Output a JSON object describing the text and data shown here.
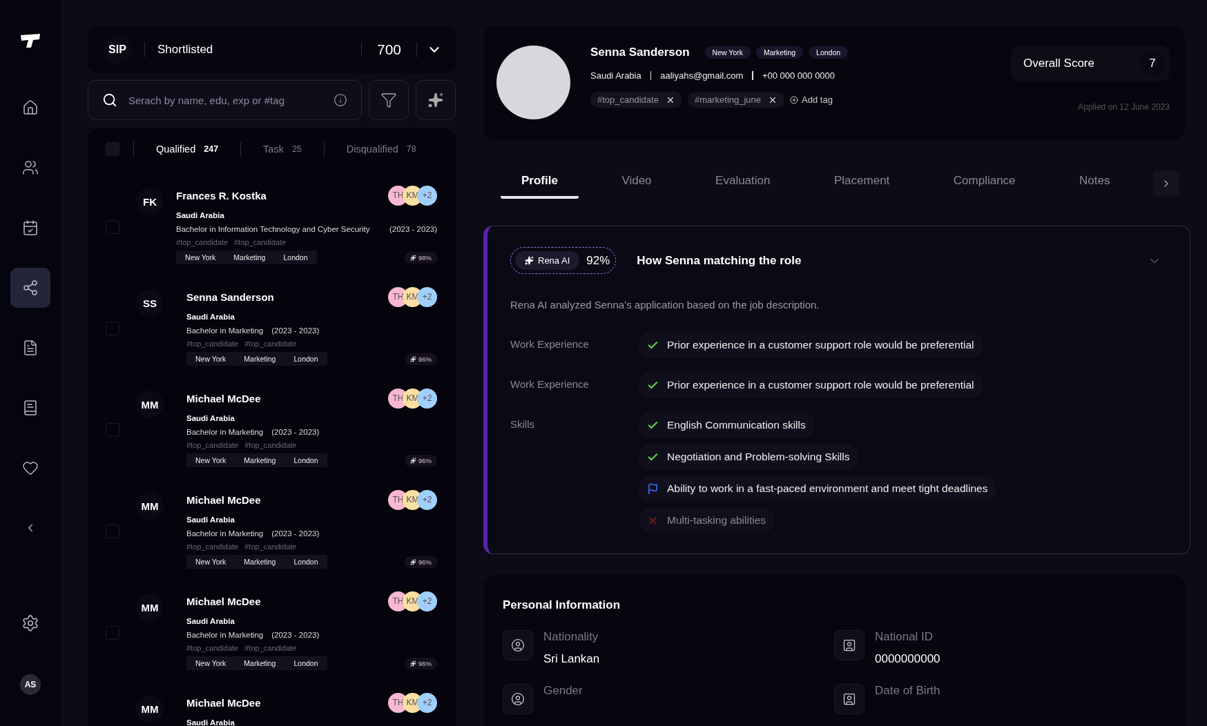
{
  "sidebar": {
    "items": [
      {
        "selected": false
      },
      {
        "selected": false
      },
      {
        "selected": false
      },
      {
        "selected": true
      },
      {
        "selected": false
      },
      {
        "selected": false
      },
      {
        "selected": false
      }
    ],
    "user_initials": "AS"
  },
  "pipeline": {
    "code": "SIP",
    "stage": "Shortlisted",
    "count": "700"
  },
  "search": {
    "placeholder": "Serach by name, edu, exp or #tag"
  },
  "list_tabs": [
    {
      "label": "Qualified",
      "count": "247",
      "selected": true
    },
    {
      "label": "Task",
      "count": "25",
      "selected": false
    },
    {
      "label": "Disqualified",
      "count": "78",
      "selected": false
    }
  ],
  "select_all": {
    "checked": false
  },
  "candidates": [
    {
      "initials": "FK",
      "name": "Frances R. Kostka",
      "country": "Saudi Arabia",
      "education": "Bachelor in Information Technology and Cyber Security",
      "years": "(2023 - 2023)",
      "hashtags": [
        "#top_candidate",
        "#top_candidate"
      ],
      "tags": [
        "New York",
        "Marketing",
        "London"
      ],
      "reviewers": [
        "TH",
        "KM",
        "+2"
      ],
      "match": "98%",
      "checked": false
    },
    {
      "initials": "SS",
      "name": "Senna Sanderson",
      "country": "Saudi Arabia",
      "education": "Bachelor in Marketing",
      "years": "(2023 - 2023)",
      "hashtags": [
        "#top_candidate",
        "#top_candidate"
      ],
      "tags": [
        "New York",
        "Marketing",
        "London"
      ],
      "reviewers": [
        "TH",
        "KM",
        "+2"
      ],
      "match": "96%",
      "checked": false
    },
    {
      "initials": "MM",
      "name": "Michael McDee",
      "country": "Saudi Arabia",
      "education": "Bachelor in Marketing",
      "years": "(2023 - 2023)",
      "hashtags": [
        "#top_candidate",
        "#top_candidate"
      ],
      "tags": [
        "New York",
        "Marketing",
        "London"
      ],
      "reviewers": [
        "TH",
        "KM",
        "+2"
      ],
      "match": "96%",
      "checked": false
    },
    {
      "initials": "MM",
      "name": "Michael McDee",
      "country": "Saudi Arabia",
      "education": "Bachelor in Marketing",
      "years": "(2023 - 2023)",
      "hashtags": [
        "#top_candidate",
        "#top_candidate"
      ],
      "tags": [
        "New York",
        "Marketing",
        "London"
      ],
      "reviewers": [
        "TH",
        "KM",
        "+2"
      ],
      "match": "96%",
      "checked": false
    },
    {
      "initials": "MM",
      "name": "Michael McDee",
      "country": "Saudi Arabia",
      "education": "Bachelor in Marketing",
      "years": "(2023 - 2023)",
      "hashtags": [
        "#top_candidate",
        "#top_candidate"
      ],
      "tags": [
        "New York",
        "Marketing",
        "London"
      ],
      "reviewers": [
        "TH",
        "KM",
        "+2"
      ],
      "match": "96%",
      "checked": false
    },
    {
      "initials": "MM",
      "name": "Michael McDee",
      "country": "Saudi Arabia",
      "reviewers": [
        "TH",
        "KM",
        "+2"
      ]
    }
  ],
  "profile": {
    "name": "Senna Sanderson",
    "tags": [
      "New York",
      "Marketing",
      "London"
    ],
    "country": "Saudi Arabia",
    "email": "aaliyahs@gmail.com",
    "phone": "+00 000 000 0000",
    "hashtags": [
      "#top_candidate",
      "#marketing_june"
    ],
    "add_tag": "Add tag",
    "score_label": "Overall Score",
    "score": "7",
    "applied": "Applied on 12 June 2023"
  },
  "tabs": [
    {
      "label": "Profile",
      "selected": true
    },
    {
      "label": "Video",
      "selected": false
    },
    {
      "label": "Evaluation",
      "selected": false
    },
    {
      "label": "Placement",
      "selected": false
    },
    {
      "label": "Compliance",
      "selected": false
    },
    {
      "label": "Notes",
      "selected": false
    }
  ],
  "match_card": {
    "ai_label": "Rena AI",
    "percent": "92%",
    "title": "How Senna matching the role",
    "expanded": true,
    "summary": "Rena AI analyzed  Senna’s application based on the job description.",
    "groups": [
      {
        "label": "Work Experience",
        "items": [
          {
            "text": "Prior experience in a customer support role would be preferential",
            "kind": "met"
          }
        ]
      },
      {
        "label": "Work Experience",
        "items": [
          {
            "text": "Prior experience in a customer support role would be preferential",
            "kind": "met"
          }
        ]
      },
      {
        "label": "Skills",
        "items": [
          {
            "text": "English Communication skills",
            "kind": "met"
          },
          {
            "text": "Negotiation and Problem-solving Skills",
            "kind": "met"
          },
          {
            "text": "Ability to work in a fast-paced environment and meet tight deadlines",
            "kind": "flagged"
          },
          {
            "text": "Multi-tasking abilities",
            "kind": "unmet"
          }
        ]
      }
    ]
  },
  "personal_info": {
    "title": "Personal Information",
    "fields": [
      {
        "label": "Nationality",
        "value": "Sri Lankan"
      },
      {
        "label": "National ID",
        "value": "0000000000"
      },
      {
        "label": "Gender"
      },
      {
        "label": "Date of Birth"
      }
    ]
  }
}
